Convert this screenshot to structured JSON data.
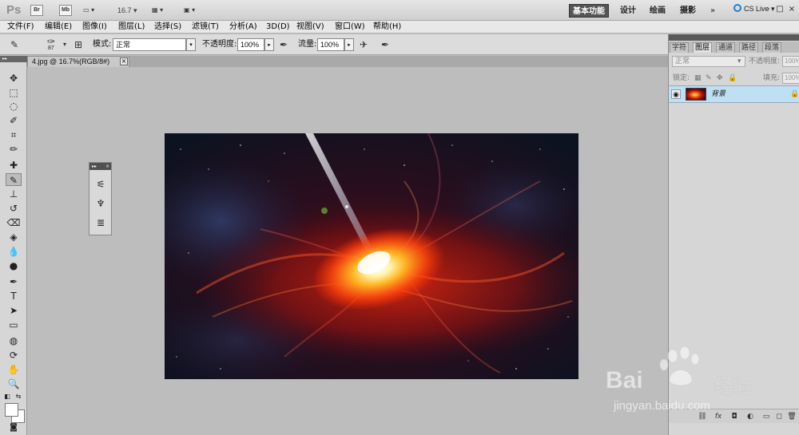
{
  "appbar": {
    "logo": "Ps",
    "bridge": "Br",
    "minibridge": "Mb",
    "zoom": "16.7",
    "workspaces": [
      "基本功能",
      "设计",
      "绘画",
      "摄影"
    ],
    "more": "»",
    "cslive": "CS Live",
    "window_controls": [
      "–",
      "□",
      "×"
    ]
  },
  "menu": [
    "文件(F)",
    "编辑(E)",
    "图像(I)",
    "图层(L)",
    "选择(S)",
    "滤镜(T)",
    "分析(A)",
    "3D(D)",
    "视图(V)",
    "窗口(W)",
    "帮助(H)"
  ],
  "options": {
    "brush_size": "87",
    "mode_label": "模式:",
    "mode_value": "正常",
    "opacity_label": "不透明度:",
    "opacity_value": "100%",
    "flow_label": "流量:",
    "flow_value": "100%"
  },
  "document": {
    "tab_title": "4.jpg @ 16.7%(RGB/8#)",
    "close": "×"
  },
  "layers_panel": {
    "tabs": [
      "字符",
      "图层",
      "通道",
      "路径",
      "段落"
    ],
    "active_tab": "图层",
    "blend_mode": "正常",
    "opacity_label": "不透明度:",
    "opacity_value": "100%",
    "lock_label": "锁定:",
    "fill_label": "填充:",
    "fill_value": "100%",
    "layer_name": "背景"
  },
  "watermark": {
    "brand_text": "Bai",
    "brand_text2": "du",
    "cn_text": "经验",
    "url": "jingyan.baidu.com"
  },
  "colors": {
    "accent_blue": "#1e7fd0",
    "layer_selected": "#bfe0f2",
    "canvas_bg": "#bdbdbd"
  }
}
